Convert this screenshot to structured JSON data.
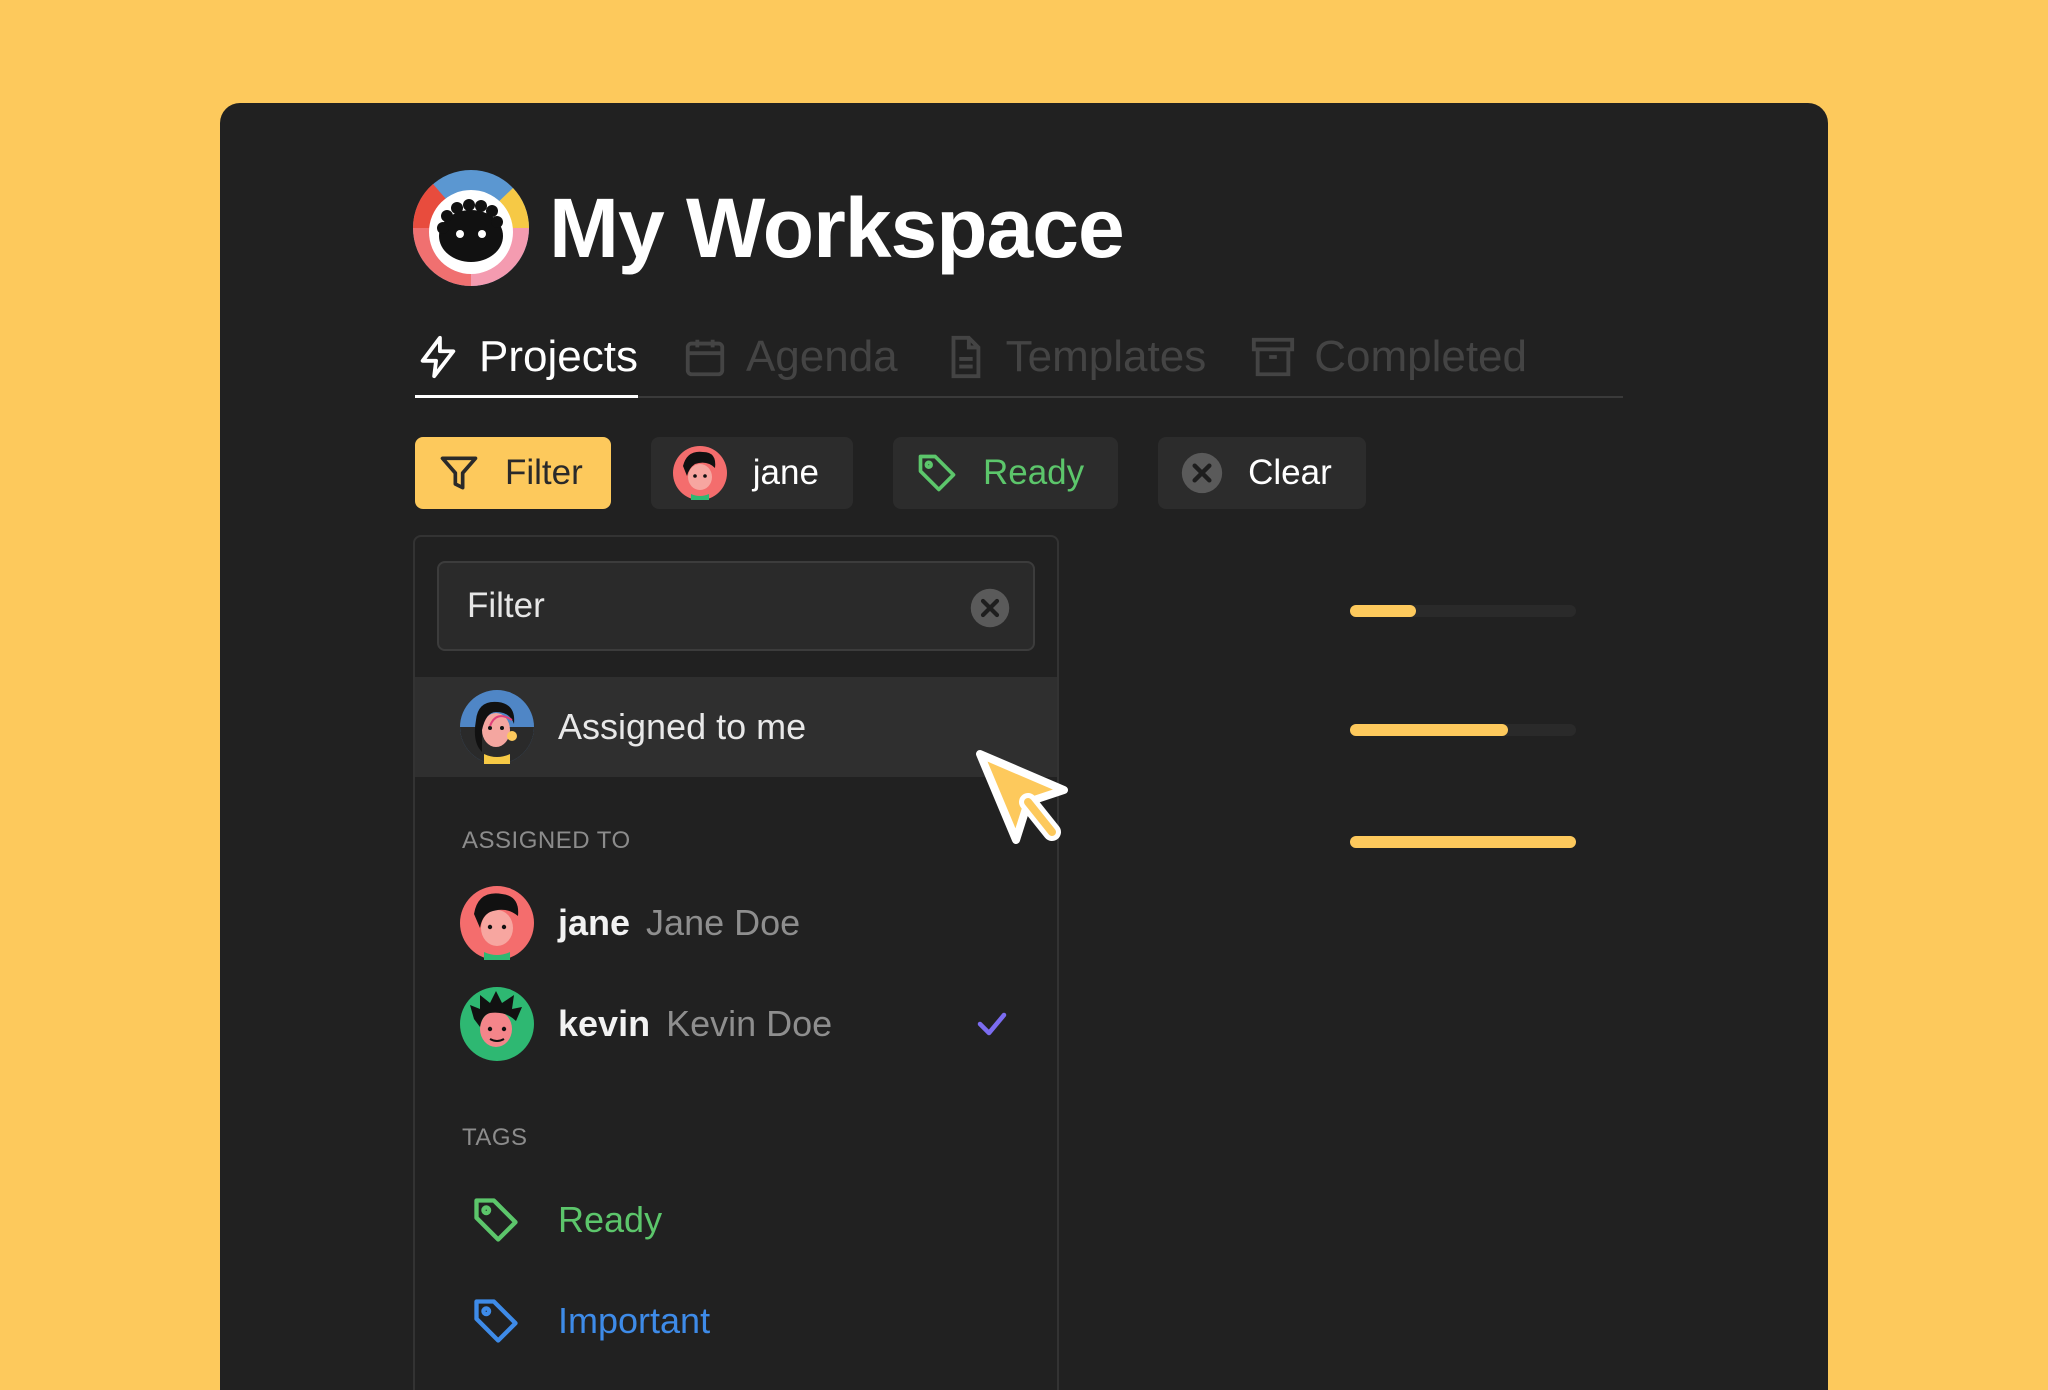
{
  "workspace": {
    "title": "My Workspace"
  },
  "tabs": [
    {
      "label": "Projects",
      "icon": "lightning-icon",
      "active": true
    },
    {
      "label": "Agenda",
      "icon": "calendar-icon",
      "active": false
    },
    {
      "label": "Templates",
      "icon": "document-icon",
      "active": false
    },
    {
      "label": "Completed",
      "icon": "archive-icon",
      "active": false
    }
  ],
  "chips": {
    "filter": "Filter",
    "user": "jane",
    "tag": "Ready",
    "clear": "Clear"
  },
  "dropdown": {
    "search_value": "Filter",
    "assigned_to_me": "Assigned to me",
    "assigned_to_label": "ASSIGNED TO",
    "users": [
      {
        "username": "jane",
        "fullname": "Jane Doe",
        "selected": false
      },
      {
        "username": "kevin",
        "fullname": "Kevin Doe",
        "selected": true
      }
    ],
    "tags_label": "TAGS",
    "tags": [
      {
        "label": "Ready",
        "color": "#5CC66B"
      },
      {
        "label": "Important",
        "color": "#3E8BE8"
      }
    ]
  },
  "progress_bars": [
    0.29,
    0.7,
    1.0
  ],
  "colors": {
    "accent": "#FDC95C",
    "background": "#212121",
    "ready": "#5CC66B",
    "important": "#3E8BE8",
    "check": "#7B6CF0"
  }
}
